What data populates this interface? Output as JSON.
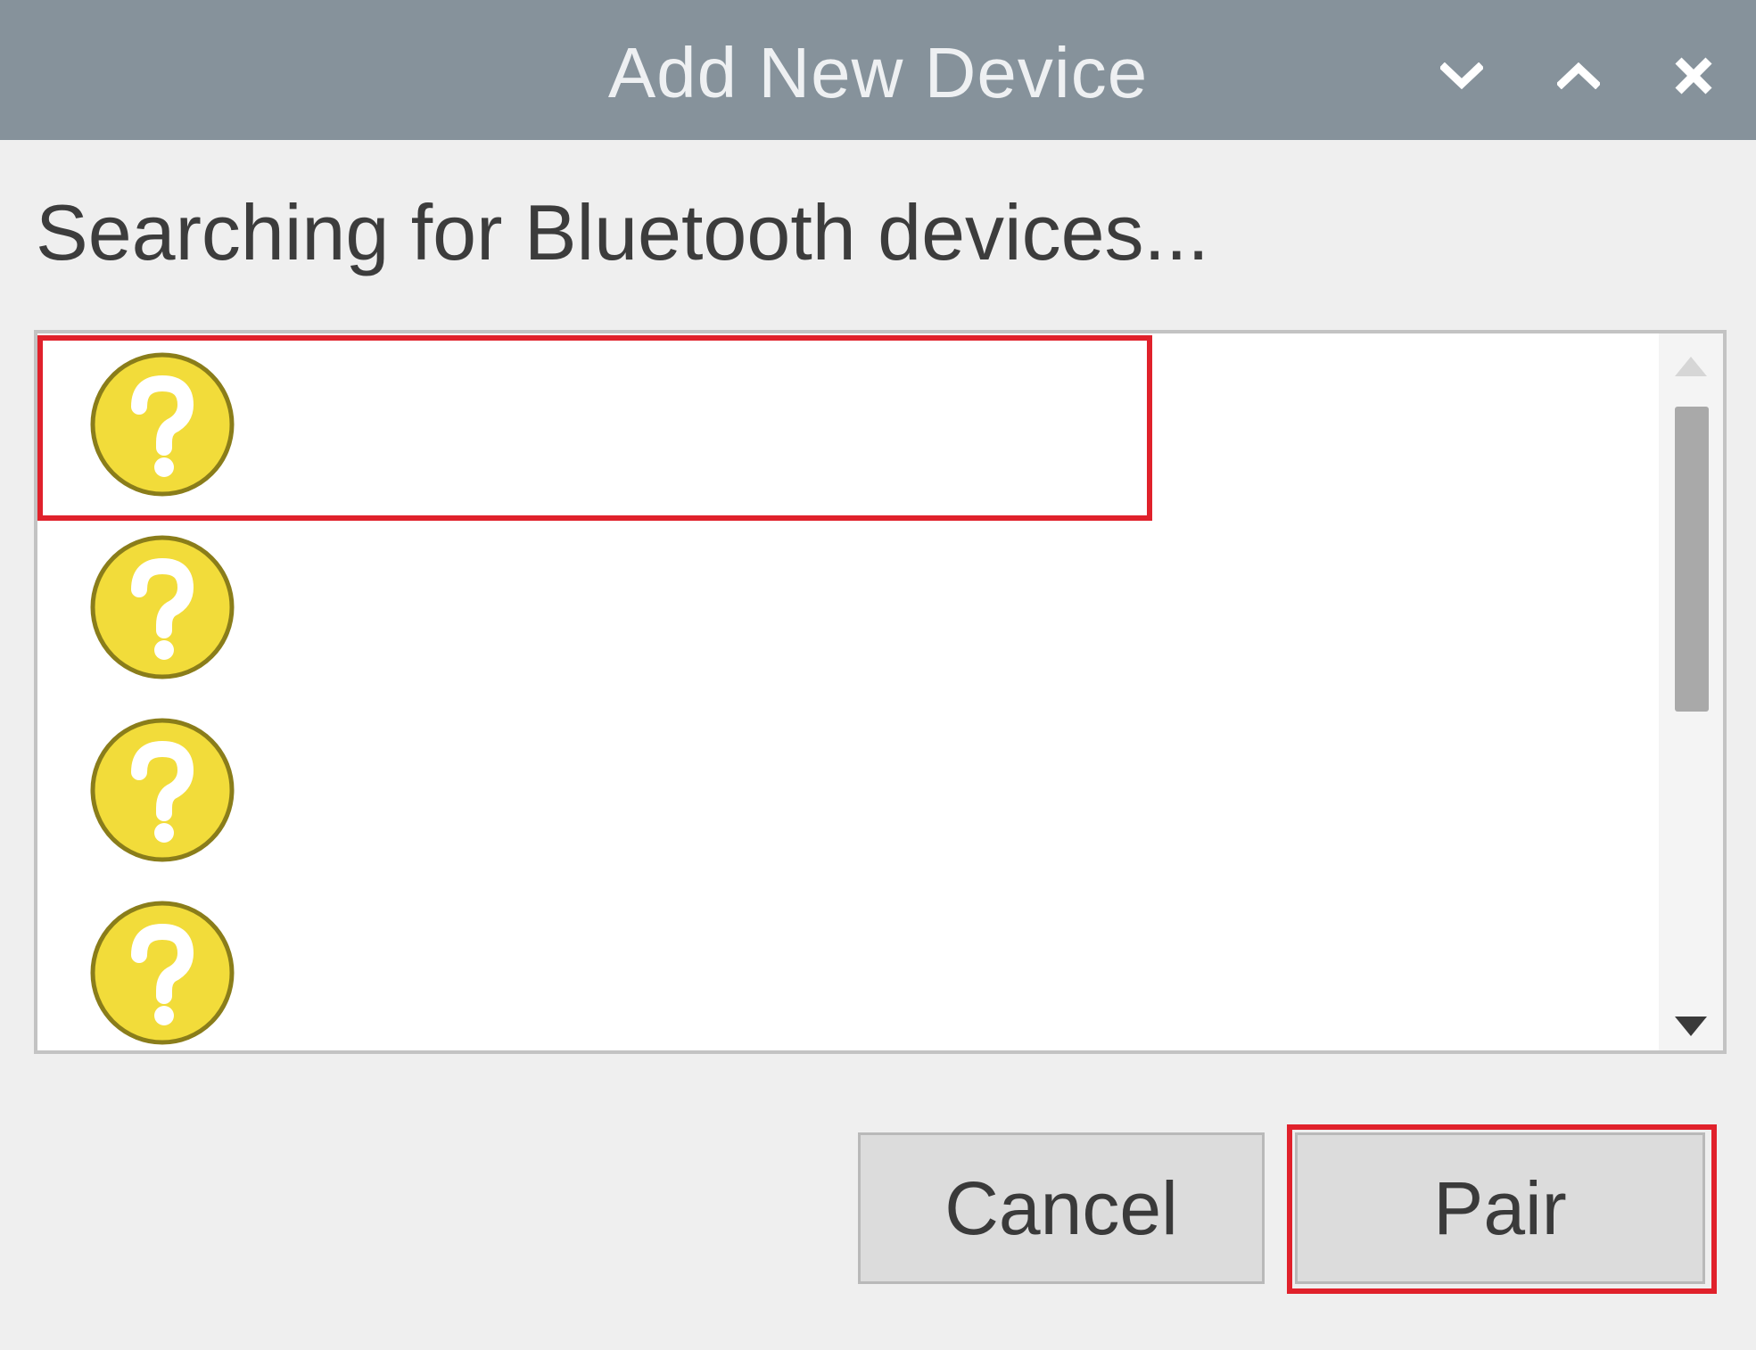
{
  "window": {
    "title": "Add New Device",
    "controls": {
      "minimize_icon": "chevron-down-icon",
      "maximize_icon": "chevron-up-icon",
      "close_icon": "close-icon"
    }
  },
  "main": {
    "status_text": "Searching for Bluetooth devices..."
  },
  "device_list": {
    "items": [
      {
        "icon": "unknown-device-icon",
        "name": "",
        "selected": true
      },
      {
        "icon": "unknown-device-icon",
        "name": "",
        "selected": false
      },
      {
        "icon": "unknown-device-icon",
        "name": "",
        "selected": false
      },
      {
        "icon": "unknown-device-icon",
        "name": "",
        "selected": false
      }
    ]
  },
  "buttons": {
    "cancel_label": "Cancel",
    "pair_label": "Pair"
  },
  "colors": {
    "titlebar": "#86929b",
    "highlight": "#e0212b",
    "device_icon_fill": "#f2dc3a",
    "device_icon_stroke": "#8a7d1a"
  }
}
